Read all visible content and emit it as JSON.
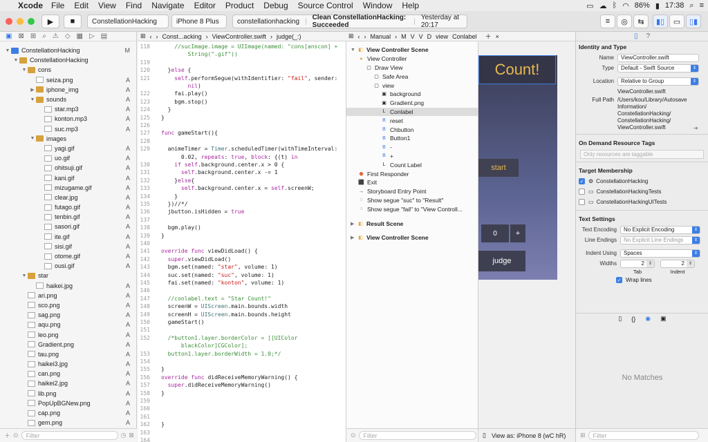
{
  "menubar": {
    "apple": "",
    "app": "Xcode",
    "items": [
      "File",
      "Edit",
      "View",
      "Find",
      "Navigate",
      "Editor",
      "Product",
      "Debug",
      "Source Control",
      "Window",
      "Help"
    ],
    "battery": "86%",
    "clock": "17:38"
  },
  "toolbar": {
    "scheme": "ConstellationHacking",
    "device": "iPhone 8 Plus",
    "activity_project": "constellationhacking",
    "activity_status": "Clean ConstellationHacking: Succeeded",
    "activity_time": "Yesterday at 20:17"
  },
  "navigator": {
    "filter_placeholder": "Filter",
    "items": [
      {
        "label": "ConstellationHacking",
        "badge": "M",
        "indent": 0,
        "kind": "project",
        "open": true
      },
      {
        "label": "ConstellationHacking",
        "badge": "",
        "indent": 1,
        "kind": "folder",
        "open": true
      },
      {
        "label": "cons",
        "badge": "",
        "indent": 2,
        "kind": "folder",
        "open": true
      },
      {
        "label": "seiza.png",
        "badge": "A",
        "indent": 3,
        "kind": "file"
      },
      {
        "label": "iphone_img",
        "badge": "A",
        "indent": 3,
        "kind": "folder",
        "open": false
      },
      {
        "label": "sounds",
        "badge": "A",
        "indent": 3,
        "kind": "folder",
        "open": true
      },
      {
        "label": "star.mp3",
        "badge": "A",
        "indent": 4,
        "kind": "file"
      },
      {
        "label": "konton.mp3",
        "badge": "A",
        "indent": 4,
        "kind": "file"
      },
      {
        "label": "suc.mp3",
        "badge": "A",
        "indent": 4,
        "kind": "file"
      },
      {
        "label": "images",
        "badge": "",
        "indent": 3,
        "kind": "folder",
        "open": true
      },
      {
        "label": "yagi.gif",
        "badge": "A",
        "indent": 4,
        "kind": "file"
      },
      {
        "label": "uo.gif",
        "badge": "A",
        "indent": 4,
        "kind": "file"
      },
      {
        "label": "ohitsuji.gif",
        "badge": "A",
        "indent": 4,
        "kind": "file"
      },
      {
        "label": "kani.gif",
        "badge": "A",
        "indent": 4,
        "kind": "file"
      },
      {
        "label": "mizugame.gif",
        "badge": "A",
        "indent": 4,
        "kind": "file"
      },
      {
        "label": "clear.jpg",
        "badge": "A",
        "indent": 4,
        "kind": "file"
      },
      {
        "label": "futago.gif",
        "badge": "A",
        "indent": 4,
        "kind": "file"
      },
      {
        "label": "tenbin.gif",
        "badge": "A",
        "indent": 4,
        "kind": "file"
      },
      {
        "label": "sasori.gif",
        "badge": "A",
        "indent": 4,
        "kind": "file"
      },
      {
        "label": "ite.gif",
        "badge": "A",
        "indent": 4,
        "kind": "file"
      },
      {
        "label": "sisi.gif",
        "badge": "A",
        "indent": 4,
        "kind": "file"
      },
      {
        "label": "otome.gif",
        "badge": "A",
        "indent": 4,
        "kind": "file"
      },
      {
        "label": "ousi.gif",
        "badge": "A",
        "indent": 4,
        "kind": "file"
      },
      {
        "label": "star",
        "badge": "",
        "indent": 2,
        "kind": "folder",
        "open": true
      },
      {
        "label": "haikei.jpg",
        "badge": "A",
        "indent": 3,
        "kind": "file"
      },
      {
        "label": "ari.png",
        "badge": "A",
        "indent": 2,
        "kind": "file"
      },
      {
        "label": "sco.png",
        "badge": "A",
        "indent": 2,
        "kind": "file"
      },
      {
        "label": "sag.png",
        "badge": "A",
        "indent": 2,
        "kind": "file"
      },
      {
        "label": "aqu.png",
        "badge": "A",
        "indent": 2,
        "kind": "file"
      },
      {
        "label": "leo.png",
        "badge": "A",
        "indent": 2,
        "kind": "file"
      },
      {
        "label": "Gradient.png",
        "badge": "A",
        "indent": 2,
        "kind": "file"
      },
      {
        "label": "tau.png",
        "badge": "A",
        "indent": 2,
        "kind": "file"
      },
      {
        "label": "haikei3.jpg",
        "badge": "A",
        "indent": 2,
        "kind": "file"
      },
      {
        "label": "can.png",
        "badge": "A",
        "indent": 2,
        "kind": "file"
      },
      {
        "label": "haikei2.jpg",
        "badge": "A",
        "indent": 2,
        "kind": "file"
      },
      {
        "label": "lib.png",
        "badge": "A",
        "indent": 2,
        "kind": "file"
      },
      {
        "label": "PopUpBGNew.png",
        "badge": "A",
        "indent": 2,
        "kind": "file"
      },
      {
        "label": "cap.png",
        "badge": "A",
        "indent": 2,
        "kind": "file"
      },
      {
        "label": "gem.png",
        "badge": "A",
        "indent": 2,
        "kind": "file"
      }
    ]
  },
  "editor": {
    "jump": [
      "Const...acking",
      "ViewController.swift",
      "judge(_:)"
    ],
    "lines": [
      {
        "n": "118",
        "t": "    //sucImage.image = UIImage(named: \"cons[anscon] +",
        "c": "cm"
      },
      {
        "n": "",
        "t": "        String(\".gif\"))",
        "c": "cm"
      },
      {
        "n": "119",
        "t": "",
        "c": ""
      },
      {
        "n": "120",
        "t": "  }else {",
        "c": ""
      },
      {
        "n": "121",
        "t": "    self.performSegue(withIdentifier: \"fail\", sender:",
        "c": ""
      },
      {
        "n": "",
        "t": "        nil)",
        "c": ""
      },
      {
        "n": "122",
        "t": "    fai.play()",
        "c": ""
      },
      {
        "n": "123",
        "t": "    bgm.stop()",
        "c": ""
      },
      {
        "n": "124",
        "t": "  }",
        "c": ""
      },
      {
        "n": "125",
        "t": "}",
        "c": ""
      },
      {
        "n": "126",
        "t": "",
        "c": ""
      },
      {
        "n": "127",
        "t": "func gameStart(){",
        "c": ""
      },
      {
        "n": "128",
        "t": "",
        "c": ""
      },
      {
        "n": "129",
        "t": "  animeTimer = Timer.scheduledTimer(withTimeInterval:",
        "c": ""
      },
      {
        "n": "",
        "t": "      0.02, repeats: true, block: {(t) in",
        "c": ""
      },
      {
        "n": "130",
        "t": "    if self.background.center.x > 0 {",
        "c": ""
      },
      {
        "n": "131",
        "t": "      self.background.center.x -= 1",
        "c": ""
      },
      {
        "n": "132",
        "t": "    }else{",
        "c": ""
      },
      {
        "n": "133",
        "t": "      self.background.center.x = self.screenW;",
        "c": ""
      },
      {
        "n": "134",
        "t": "    }",
        "c": ""
      },
      {
        "n": "135",
        "t": "  })//*/",
        "c": ""
      },
      {
        "n": "136",
        "t": "  jbutton.isHidden = true",
        "c": ""
      },
      {
        "n": "137",
        "t": "",
        "c": ""
      },
      {
        "n": "138",
        "t": "  bgm.play()",
        "c": ""
      },
      {
        "n": "139",
        "t": "}",
        "c": ""
      },
      {
        "n": "140",
        "t": "",
        "c": ""
      },
      {
        "n": "141",
        "t": "override func viewDidLoad() {",
        "c": ""
      },
      {
        "n": "142",
        "t": "  super.viewDidLoad()",
        "c": ""
      },
      {
        "n": "143",
        "t": "  bgm.set(named: \"star\", volume: 1)",
        "c": ""
      },
      {
        "n": "144",
        "t": "  suc.set(named: \"suc\", volume: 1)",
        "c": ""
      },
      {
        "n": "145",
        "t": "  fai.set(named: \"konton\", volume: 1)",
        "c": ""
      },
      {
        "n": "146",
        "t": "",
        "c": ""
      },
      {
        "n": "147",
        "t": "  //conlabel.text = \"Star Count!\"",
        "c": "cm"
      },
      {
        "n": "148",
        "t": "  screenW = UIScreen.main.bounds.width",
        "c": ""
      },
      {
        "n": "149",
        "t": "  screenH = UIScreen.main.bounds.height",
        "c": ""
      },
      {
        "n": "150",
        "t": "  gameStart()",
        "c": ""
      },
      {
        "n": "151",
        "t": "",
        "c": ""
      },
      {
        "n": "152",
        "t": "  /*button1.layer.borderColor = [[UIColor",
        "c": "cm"
      },
      {
        "n": "",
        "t": "      blackColor]CGColor];",
        "c": "cm"
      },
      {
        "n": "153",
        "t": "  button1.layer.borderWidth = 1.0;*/",
        "c": "cm"
      },
      {
        "n": "154",
        "t": "",
        "c": ""
      },
      {
        "n": "155",
        "t": "}",
        "c": ""
      },
      {
        "n": "156",
        "t": "override func didReceiveMemoryWarning() {",
        "c": ""
      },
      {
        "n": "157",
        "t": "  super.didReceiveMemoryWarning()",
        "c": ""
      },
      {
        "n": "158",
        "t": "}",
        "c": ""
      },
      {
        "n": "159",
        "t": "",
        "c": ""
      },
      {
        "n": "160",
        "t": "",
        "c": ""
      },
      {
        "n": "161",
        "t": "",
        "c": ""
      },
      {
        "n": "162",
        "t": "}",
        "c": ""
      },
      {
        "n": "163",
        "t": "",
        "c": ""
      },
      {
        "n": "164",
        "t": "",
        "c": ""
      }
    ]
  },
  "outline": {
    "jump": [
      "Manual",
      "M",
      "V",
      "V",
      "D",
      "view",
      "Conlabel"
    ],
    "filter_placeholder": "Filter",
    "items": [
      {
        "label": "View Controller Scene",
        "indent": 0,
        "icon": "scene",
        "bold": true
      },
      {
        "label": "View Controller",
        "indent": 1,
        "icon": "vc"
      },
      {
        "label": "Draw View",
        "indent": 2,
        "icon": "view"
      },
      {
        "label": "Safe Area",
        "indent": 3,
        "icon": "view"
      },
      {
        "label": "view",
        "indent": 3,
        "icon": "view"
      },
      {
        "label": "background",
        "indent": 4,
        "icon": "img"
      },
      {
        "label": "Gradient.png",
        "indent": 4,
        "icon": "img"
      },
      {
        "label": "Conlabel",
        "indent": 4,
        "icon": "L",
        "selected": true
      },
      {
        "label": "reset",
        "indent": 4,
        "icon": "B"
      },
      {
        "label": "Chbutton",
        "indent": 4,
        "icon": "B"
      },
      {
        "label": "Button1",
        "indent": 4,
        "icon": "B"
      },
      {
        "label": "-",
        "indent": 4,
        "icon": "B"
      },
      {
        "label": "+",
        "indent": 4,
        "icon": "B"
      },
      {
        "label": "Count Label",
        "indent": 4,
        "icon": "L"
      },
      {
        "label": "First Responder",
        "indent": 1,
        "icon": "fr"
      },
      {
        "label": "Exit",
        "indent": 1,
        "icon": "exit"
      },
      {
        "label": "Storyboard Entry Point",
        "indent": 1,
        "icon": "entry"
      },
      {
        "label": "Show segue \"suc\" to \"Result\"",
        "indent": 1,
        "icon": "segue"
      },
      {
        "label": "Show segue \"fail\" to \"View Controll...",
        "indent": 1,
        "icon": "segue"
      },
      {
        "label": "",
        "indent": 0,
        "icon": "gap"
      },
      {
        "label": "Result Scene",
        "indent": 0,
        "icon": "scene",
        "bold": true
      },
      {
        "label": "",
        "indent": 0,
        "icon": "gap"
      },
      {
        "label": "View Controller Scene",
        "indent": 0,
        "icon": "scene",
        "bold": true
      }
    ]
  },
  "canvas": {
    "title": "Count!",
    "start": "start",
    "count": "0",
    "plus": "+",
    "judge": "judge",
    "view_as": "View as: iPhone 8 (wC hR)"
  },
  "inspector": {
    "identity_title": "Identity and Type",
    "name_label": "Name",
    "name_value": "ViewController.swift",
    "type_label": "Type",
    "type_value": "Default - Swift Source",
    "location_label": "Location",
    "location_value": "Relative to Group",
    "location_file": "ViewController.swift",
    "fullpath_label": "Full Path",
    "fullpath_value": "/Users/kou/Library/Autosave Information/ ConstellationHacking/ ConstellationHacking/ ViewController.swift",
    "odr_title": "On Demand Resource Tags",
    "odr_placeholder": "Only resources are taggable",
    "target_title": "Target Membership",
    "targets": [
      {
        "label": "ConstellationHacking",
        "checked": true
      },
      {
        "label": "ConstellationHackingTests",
        "checked": false
      },
      {
        "label": "ConstellationHackingUITests",
        "checked": false
      }
    ],
    "text_title": "Text Settings",
    "encoding_label": "Text Encoding",
    "encoding_value": "No Explicit Encoding",
    "endings_label": "Line Endings",
    "endings_value": "No Explicit Line Endings",
    "indent_label": "Indent Using",
    "indent_value": "Spaces",
    "widths_label": "Widths",
    "tab_value": "2",
    "indent_width_value": "2",
    "tab_label": "Tab",
    "indent_sub_label": "Indent",
    "wrap_label": "Wrap lines",
    "no_matches": "No Matches",
    "filter_placeholder": "Filter"
  }
}
